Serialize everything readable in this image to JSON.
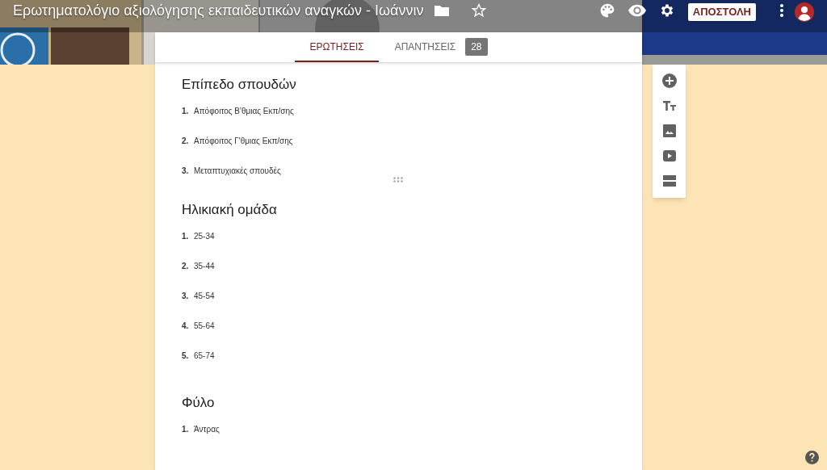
{
  "header": {
    "title": "Ερωτηματολόγιο αξιολόγησης εκπαιδευτικών αναγκών - Ιωάννιν",
    "starred": false,
    "send_button": "ΑΠΟΣΤΟΛΗ"
  },
  "tabs": [
    {
      "label": "ΕΡΩΤΗΣΕΙΣ",
      "selected": true
    },
    {
      "label": "ΑΠΑΝΤΗΣΕΙΣ",
      "selected": false,
      "badge": "28"
    }
  ],
  "questions": [
    {
      "title": "Επίπεδο σπουδών",
      "drag_handle": false,
      "options": [
        {
          "number": "1.",
          "text": "Απόφοιτος Β'θμιας Εκπ/σης"
        },
        {
          "number": "2.",
          "text": "Απόφοιτος Γ'θμιας Εκπ/σης"
        },
        {
          "number": "3.",
          "text": "Μεταπτυχιακές σπουδές"
        }
      ]
    },
    {
      "title": "Ηλικιακή ομάδα",
      "drag_handle": true,
      "options": [
        {
          "number": "1.",
          "text": "25-34"
        },
        {
          "number": "2.",
          "text": "35-44"
        },
        {
          "number": "3.",
          "text": "45-54"
        },
        {
          "number": "4.",
          "text": "55-64"
        },
        {
          "number": "5.",
          "text": "65-74"
        }
      ]
    },
    {
      "title": "Φύλο",
      "drag_handle": false,
      "options": [
        {
          "number": "1.",
          "text": "Άντρας"
        }
      ]
    }
  ]
}
